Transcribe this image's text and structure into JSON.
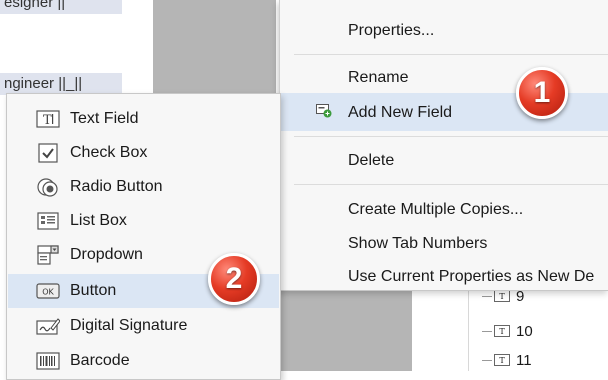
{
  "document": {
    "field_top": "esigner ||",
    "field_mid": "ngineer ||_||",
    "tree_items": [
      {
        "label": "9"
      },
      {
        "label": "10"
      },
      {
        "label": "11"
      }
    ],
    "tree_icon_glyph": "T"
  },
  "context_menu": {
    "items": [
      {
        "label": "Properties..."
      },
      {
        "label": "Rename"
      },
      {
        "label": "Add New Field",
        "icon": "add-field-icon",
        "highlighted": true
      },
      {
        "label": "Delete"
      },
      {
        "label": "Create Multiple Copies..."
      },
      {
        "label": "Show Tab Numbers"
      },
      {
        "label": "Use Current Properties as New De"
      }
    ]
  },
  "submenu": {
    "items": [
      {
        "label": "Text Field",
        "icon": "text-field-icon"
      },
      {
        "label": "Check Box",
        "icon": "check-box-icon"
      },
      {
        "label": "Radio Button",
        "icon": "radio-button-icon"
      },
      {
        "label": "List Box",
        "icon": "list-box-icon"
      },
      {
        "label": "Dropdown",
        "icon": "dropdown-icon"
      },
      {
        "label": "Button",
        "icon": "button-icon",
        "highlighted": true
      },
      {
        "label": "Digital Signature",
        "icon": "digital-signature-icon"
      },
      {
        "label": "Barcode",
        "icon": "barcode-icon"
      }
    ],
    "button_icon_text": "OK"
  },
  "badges": {
    "step1": "1",
    "step2": "2"
  },
  "colors": {
    "highlight": "#dbe6f4",
    "menu_bg": "#f7f7f7",
    "badge_red": "#e53b25",
    "grey_bg": "#b5b5b5"
  }
}
